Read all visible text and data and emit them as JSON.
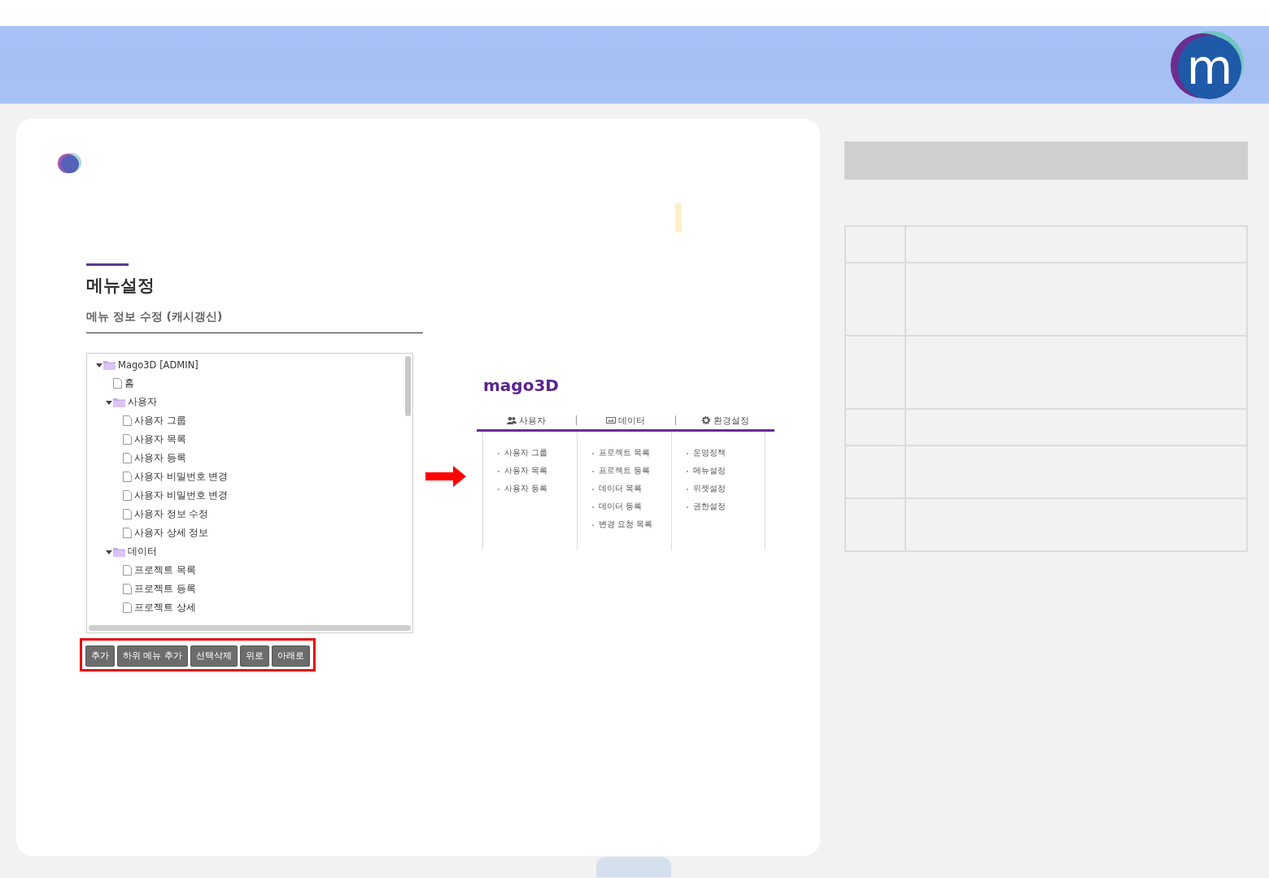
{
  "header": {
    "logo_letter": "m"
  },
  "page": {
    "title": "메뉴설정",
    "subtitle": "메뉴 정보 수정 (캐시갱신)"
  },
  "tree": [
    {
      "label": "Mago3D [ADMIN]",
      "kind": "folder",
      "expanded": true,
      "children": [
        {
          "label": "홈",
          "kind": "file"
        },
        {
          "label": "사용자",
          "kind": "folder",
          "expanded": true,
          "children": [
            {
              "label": "사용자 그룹",
              "kind": "file"
            },
            {
              "label": "사용자 목록",
              "kind": "file"
            },
            {
              "label": "사용자 등록",
              "kind": "file"
            },
            {
              "label": "사용자 비밀번호 변경",
              "kind": "file"
            },
            {
              "label": "사용자 비밀번호 변경",
              "kind": "file"
            },
            {
              "label": "사용자 정보 수정",
              "kind": "file"
            },
            {
              "label": "사용자 상세 정보",
              "kind": "file"
            }
          ]
        },
        {
          "label": "데이터",
          "kind": "folder",
          "expanded": true,
          "children": [
            {
              "label": "프로젝트 목록",
              "kind": "file"
            },
            {
              "label": "프로젝트 등록",
              "kind": "file"
            },
            {
              "label": "프로젝트 상세",
              "kind": "file"
            }
          ]
        }
      ]
    }
  ],
  "buttons": [
    "추가",
    "하위 메뉴 추가",
    "선택삭제",
    "위로",
    "아래로"
  ],
  "preview": {
    "logo": "mago3D",
    "menus": [
      {
        "label": "사용자",
        "kind": "users",
        "items": [
          "사용자 그룹",
          "사용자 목록",
          "사용자 등록"
        ]
      },
      {
        "label": "데이터",
        "kind": "image",
        "items": [
          "프로젝트 목록",
          "프로젝트 등록",
          "데이터 목록",
          "데이터 등록",
          "변경 요청 목록"
        ]
      },
      {
        "label": "환경설정",
        "kind": "gear",
        "items": [
          "운영정책",
          "메뉴설정",
          "위젯설정",
          "권한설정"
        ]
      }
    ]
  }
}
